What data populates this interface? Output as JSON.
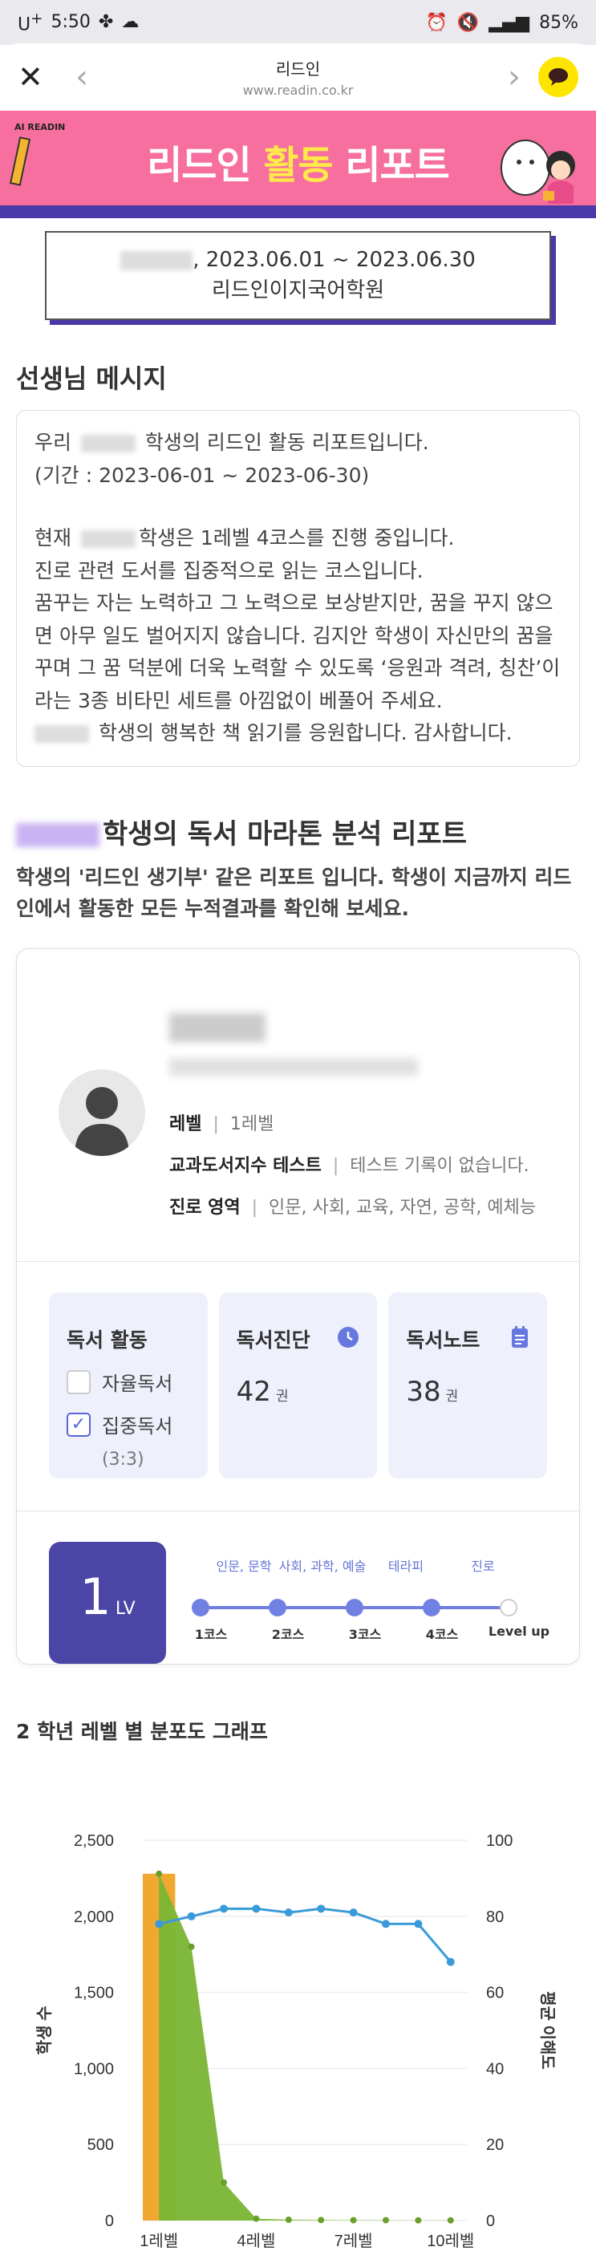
{
  "status_bar": {
    "carrier": "U",
    "carrier_plus": "+",
    "time": "5:50",
    "battery": "85%"
  },
  "browser": {
    "title": "리드인",
    "url": "www.readin.co.kr"
  },
  "banner": {
    "logo": "AI READIN",
    "title_part1": "리드인 ",
    "title_highlight": "활동",
    "title_part2": " 리포트"
  },
  "info": {
    "period": ", 2023.06.01 ~ 2023.06.30",
    "academy": "리드인이지국어학원"
  },
  "teacher_message": {
    "heading": "선생님 메시지",
    "line1_pre": "우리 ",
    "line1_post": " 학생의 리드인 활동 리포트입니다.",
    "line2": "(기간 : 2023-06-01 ~ 2023-06-30)",
    "line3_pre": "현재 ",
    "line3_post": "학생은 1레벨 4코스를 진행 중입니다.",
    "line4": "진로 관련 도서를 집중적으로 읽는 코스입니다.",
    "line5": "꿈꾸는 자는 노력하고 그 노력으로 보상받지만, 꿈을 꾸지 않으면 아무 일도 벌어지지 않습니다. 김지안 학생이 자신만의 꿈을 꾸며 그 꿈 덕분에 더욱 노력할 수 있도록 ‘응원과 격려, 칭찬’이라는 3종 비타민 세트를 아낌없이 베풀어 주세요.",
    "line6_post": " 학생의 행복한 책 읽기를 응원합니다. 감사합니다."
  },
  "marathon": {
    "title": "학생의 독서 마라톤 분석 리포트",
    "subtitle": "학생의 '리드인 생기부' 같은 리포트 입니다. 학생이 지금까지 리드인에서 활동한 모든 누적결과를 확인해 보세요."
  },
  "profile": {
    "level_label": "레벨",
    "level_value": "1레벨",
    "test_label": "교과도서지수 테스트",
    "test_value": "테스트 기록이 없습니다.",
    "career_label": "진로 영역",
    "career_value": "인문, 사회, 교육, 자연, 공학, 예체능"
  },
  "reading": {
    "activity_title": "독서 활동",
    "self_reading": "자율독서",
    "self_checked": false,
    "focus_reading": "집중독서",
    "focus_checked": true,
    "ratio": "(3:3)",
    "diagnosis_title": "독서진단",
    "diagnosis_value": "42",
    "diagnosis_unit": "권",
    "note_title": "독서노트",
    "note_value": "38",
    "note_unit": "권"
  },
  "level_progress": {
    "badge_num": "1",
    "badge_unit": "LV",
    "topics": [
      "인문, 문학",
      "사회, 과학, 예술",
      "테라피",
      "진로"
    ],
    "courses": [
      "1코스",
      "2코스",
      "3코스",
      "4코스",
      "Level up"
    ],
    "completed": 4
  },
  "graph": {
    "title": "2 학년 레벨 별 분포도 그래프"
  },
  "colors": {
    "accent": "#4b45a6",
    "banner": "#f66f9f",
    "kakao": "#fee500",
    "chart_green": "#7ab535",
    "chart_orange": "#f0a830",
    "chart_line": "#3a9ad9"
  },
  "chart_data": {
    "type": "area",
    "categories": [
      "1레벨",
      "2레벨",
      "3레벨",
      "4레벨",
      "5레벨",
      "6레벨",
      "7레벨",
      "8레벨",
      "9레벨",
      "10레벨"
    ],
    "tick_labels": [
      "1레벨",
      "4레벨",
      "7레벨",
      "10레벨"
    ],
    "ylabel": "학생 수",
    "y2label": "평균 이해도",
    "ylim": [
      0,
      2500
    ],
    "y2lim": [
      0,
      100
    ],
    "y_ticks": [
      "0",
      "500",
      "1,000",
      "1,500",
      "2,000",
      "2,500"
    ],
    "y2_ticks": [
      "0",
      "20",
      "40",
      "60",
      "80",
      "100"
    ],
    "series": [
      {
        "values": [
          2280,
          1800,
          250,
          12,
          5,
          3,
          2,
          2,
          1,
          1
        ]
      },
      {
        "values": [
          78,
          80,
          82,
          82,
          81,
          82,
          81,
          78,
          78,
          68
        ]
      }
    ],
    "highlight_category": "1레벨"
  }
}
